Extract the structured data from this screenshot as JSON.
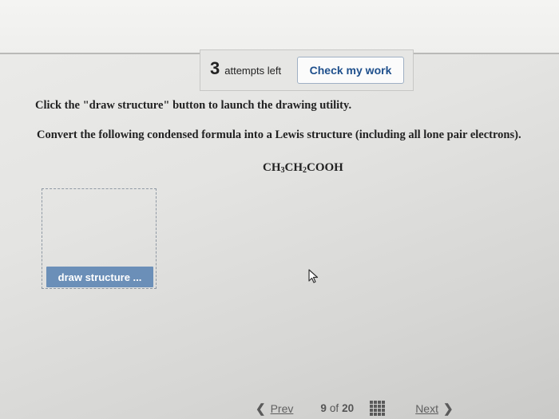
{
  "header": {
    "attempts_count": "3",
    "attempts_label": "attempts left",
    "check_button_label": "Check my work"
  },
  "question": {
    "instruction_1": "Click the \"draw structure\" button to launch the drawing utility.",
    "instruction_2": "Convert the following condensed formula into a Lewis structure (including all lone pair electrons).",
    "formula_parts": {
      "p1": "CH",
      "s1": "3",
      "p2": "CH",
      "s2": "2",
      "p3": "COOH"
    },
    "draw_button_label": "draw structure ..."
  },
  "navigation": {
    "prev_label": "Prev",
    "current_page": "9",
    "of_label": "of",
    "total_pages": "20",
    "next_label": "Next",
    "prev_icon": "chevron-left-icon",
    "next_icon": "chevron-right-icon",
    "grid_icon": "grid-icon"
  },
  "colors": {
    "check_button_text": "#1e4f8c",
    "draw_button_bg": "#6b8fb8"
  }
}
